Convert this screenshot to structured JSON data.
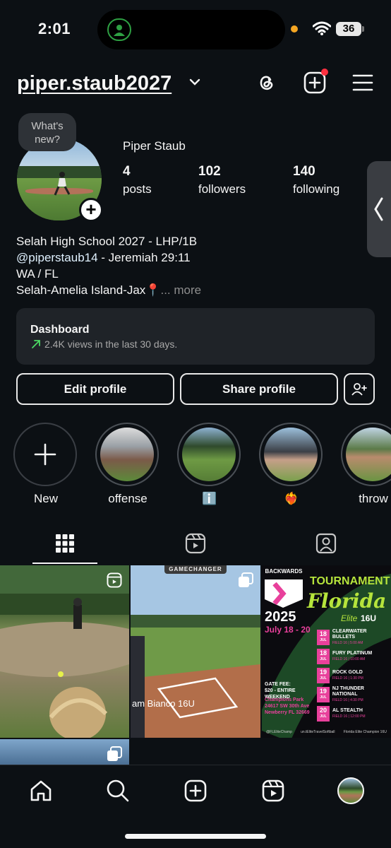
{
  "status_bar": {
    "time": "2:01",
    "battery": "36"
  },
  "header": {
    "username": "piper.staub2027"
  },
  "profile": {
    "note": "What's new?",
    "full_name": "Piper Staub",
    "stats": [
      {
        "value": "4",
        "label": "posts"
      },
      {
        "value": "102",
        "label": "followers"
      },
      {
        "value": "140",
        "label": "following"
      }
    ],
    "bio": {
      "line1": "Selah High School 2027 - LHP/1B",
      "mention": "@piperstaub14",
      "line2_rest": " - Jeremiah 29:11",
      "line3": "WA / FL",
      "line4": "Selah-Amelia Island-Jax",
      "pin": "📍",
      "more": "... more"
    }
  },
  "dashboard": {
    "title": "Dashboard",
    "subtitle": "2.4K views in the last 30 days."
  },
  "buttons": {
    "edit_profile": "Edit profile",
    "share_profile": "Share profile"
  },
  "highlights": [
    {
      "label": "New"
    },
    {
      "label": "offense"
    },
    {
      "label": "ℹ️"
    },
    {
      "label": "❤️‍🔥"
    },
    {
      "label": "throw"
    }
  ],
  "posts": {
    "post2": {
      "watermark": "GAMECHANGER",
      "caption": "am Bianco 16U"
    },
    "post3": {
      "tag": "BACKWARDS",
      "title1": "TOURNAMENT",
      "title2": "Florida",
      "title3": "Elite",
      "age": "16U",
      "year": "2025",
      "dates": "July 18 - 20",
      "gate1": "GATE FEE:",
      "gate2": "$20 - ENTIRE WEEKEND",
      "venue1": "Champions Park",
      "venue2": "24617 SW 30th Ave",
      "venue3": "Newberry FL 32669",
      "schedule": [
        {
          "day": "18",
          "mon": "JUL",
          "team": "CLEARWATER BULLETS",
          "info": "FIELD 16 | 5:00 AM"
        },
        {
          "day": "18",
          "mon": "JUL",
          "team": "FURY PLATINUM",
          "info": "FIELD 16 | 10:00 AM"
        },
        {
          "day": "19",
          "mon": "JUL",
          "team": "ROCK GOLD",
          "info": "FIELD 16 | 1:30 PM"
        },
        {
          "day": "19",
          "mon": "JUL",
          "team": "NJ THUNDER NATIONAL",
          "info": "FIELD 16 | 4:30 PM"
        },
        {
          "day": "20",
          "mon": "JUL",
          "team": "AL STEALTH",
          "info": "FIELD 16 | 12:00 PM"
        }
      ],
      "footer": [
        "@FLEliteChamp",
        "un.tEliteTravelSoftball",
        "Florida Elite Champion 16U"
      ]
    }
  },
  "colors": {
    "accent_pink": "#e8409b",
    "green_neon": "#b6e43c",
    "notif_red": "#ff3040"
  }
}
